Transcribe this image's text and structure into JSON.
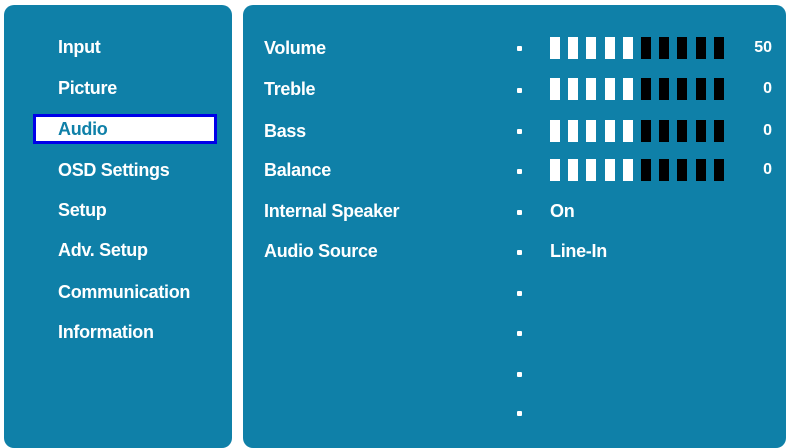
{
  "menu": {
    "items": [
      {
        "label": "Input",
        "selected": false
      },
      {
        "label": "Picture",
        "selected": false
      },
      {
        "label": "Audio",
        "selected": true
      },
      {
        "label": "OSD Settings",
        "selected": false
      },
      {
        "label": "Setup",
        "selected": false
      },
      {
        "label": "Adv. Setup",
        "selected": false
      },
      {
        "label": "Communication",
        "selected": false
      },
      {
        "label": "Information",
        "selected": false
      }
    ]
  },
  "settings": {
    "rows": [
      {
        "label": "Volume",
        "type": "slider",
        "value": "50",
        "level_fraction": 0.5
      },
      {
        "label": "Treble",
        "type": "slider",
        "value": "0",
        "level_fraction": 0.5
      },
      {
        "label": "Bass",
        "type": "slider",
        "value": "0",
        "level_fraction": 0.5
      },
      {
        "label": "Balance",
        "type": "slider",
        "value": "0",
        "level_fraction": 0.5
      },
      {
        "label": "Internal Speaker",
        "type": "option",
        "value": "On"
      },
      {
        "label": "Audio Source",
        "type": "option",
        "value": "Line-In"
      },
      {
        "label": "",
        "type": "empty"
      },
      {
        "label": "",
        "type": "empty"
      },
      {
        "label": "",
        "type": "empty"
      },
      {
        "label": "",
        "type": "empty"
      }
    ]
  },
  "colors": {
    "panel_bg": "#0f80a8",
    "highlight_border": "#0000e8",
    "slider_on": "#ffffff",
    "slider_off": "#000000"
  }
}
